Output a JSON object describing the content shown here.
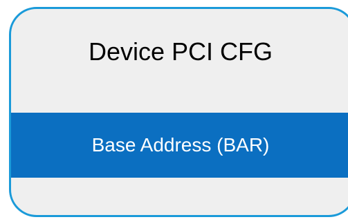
{
  "diagram": {
    "title": "Device PCI CFG",
    "field_label": "Base Address (BAR)"
  },
  "colors": {
    "border": "#1a9ad9",
    "panel_background": "#efefef",
    "field_background": "#0b6fc1",
    "field_text": "#ffffff"
  }
}
